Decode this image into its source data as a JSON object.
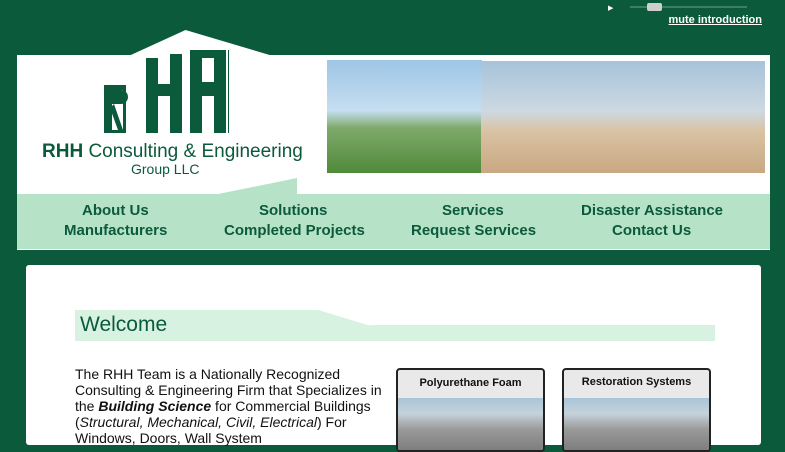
{
  "audio": {
    "play_icon": "play-icon",
    "mute_label": "mute introduction"
  },
  "company": {
    "name_bold": "RHH",
    "name_rest": " Consulting & Engineering",
    "line2": "Group LLC",
    "logo_letters": "RHH"
  },
  "nav": {
    "items": [
      "About Us",
      "Solutions",
      "Services",
      "Disaster Assistance",
      "Manufacturers",
      "Completed Projects",
      "Request Services",
      "Contact Us"
    ]
  },
  "main": {
    "welcome": "Welcome",
    "intro_1": "The RHH Team is a Nationally Recognized Consulting & Engineering Firm that Specializes in the ",
    "intro_emph": "Building Science",
    "intro_2": " for Commercial Buildings (",
    "intro_italic": "Structural, Mechanical, Civil, Electrical",
    "intro_3": ") For Windows, Doors, Wall System"
  },
  "cards": [
    {
      "title": "Polyurethane Foam"
    },
    {
      "title": "Restoration Systems"
    }
  ],
  "colors": {
    "brand_green": "#0c5a3c",
    "nav_bg": "#b6e3c8",
    "welcome_bg": "#d7f2e1"
  }
}
